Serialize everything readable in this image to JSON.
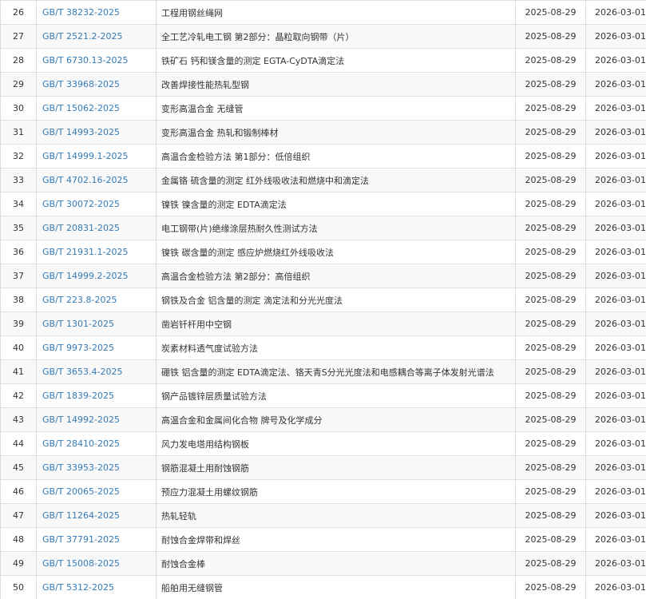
{
  "standards": [
    {
      "no": "26",
      "code": "GB/T 38232-2025",
      "name": "工程用钢丝绳网",
      "published": "2025-08-29",
      "effective": "2026-03-01"
    },
    {
      "no": "27",
      "code": "GB/T 2521.2-2025",
      "name": "全工艺冷轧电工钢 第2部分：晶粒取向钢带（片）",
      "published": "2025-08-29",
      "effective": "2026-03-01"
    },
    {
      "no": "28",
      "code": "GB/T 6730.13-2025",
      "name": "铁矿石 钙和镁含量的测定 EGTA-CyDTA滴定法",
      "published": "2025-08-29",
      "effective": "2026-03-01"
    },
    {
      "no": "29",
      "code": "GB/T 33968-2025",
      "name": "改善焊接性能热轧型钢",
      "published": "2025-08-29",
      "effective": "2026-03-01"
    },
    {
      "no": "30",
      "code": "GB/T 15062-2025",
      "name": "变形高温合金 无缝管",
      "published": "2025-08-29",
      "effective": "2026-03-01"
    },
    {
      "no": "31",
      "code": "GB/T 14993-2025",
      "name": "变形高温合金 热轧和锻制棒材",
      "published": "2025-08-29",
      "effective": "2026-03-01"
    },
    {
      "no": "32",
      "code": "GB/T 14999.1-2025",
      "name": "高温合金检验方法 第1部分：低倍组织",
      "published": "2025-08-29",
      "effective": "2026-03-01"
    },
    {
      "no": "33",
      "code": "GB/T 4702.16-2025",
      "name": "金属铬 硫含量的测定 红外线吸收法和燃烧中和滴定法",
      "published": "2025-08-29",
      "effective": "2026-03-01"
    },
    {
      "no": "34",
      "code": "GB/T 30072-2025",
      "name": "镍铁 镍含量的测定 EDTA滴定法",
      "published": "2025-08-29",
      "effective": "2026-03-01"
    },
    {
      "no": "35",
      "code": "GB/T 20831-2025",
      "name": "电工钢带(片)绝缘涂层热耐久性测试方法",
      "published": "2025-08-29",
      "effective": "2026-03-01"
    },
    {
      "no": "36",
      "code": "GB/T 21931.1-2025",
      "name": "镍铁 碳含量的测定 感应炉燃烧红外线吸收法",
      "published": "2025-08-29",
      "effective": "2026-03-01"
    },
    {
      "no": "37",
      "code": "GB/T 14999.2-2025",
      "name": "高温合金检验方法 第2部分：高倍组织",
      "published": "2025-08-29",
      "effective": "2026-03-01"
    },
    {
      "no": "38",
      "code": "GB/T 223.8-2025",
      "name": "钢铁及合金 铝含量的测定 滴定法和分光光度法",
      "published": "2025-08-29",
      "effective": "2026-03-01"
    },
    {
      "no": "39",
      "code": "GB/T 1301-2025",
      "name": "凿岩钎杆用中空钢",
      "published": "2025-08-29",
      "effective": "2026-03-01"
    },
    {
      "no": "40",
      "code": "GB/T 9973-2025",
      "name": "炭素材料透气度试验方法",
      "published": "2025-08-29",
      "effective": "2026-03-01"
    },
    {
      "no": "41",
      "code": "GB/T 3653.4-2025",
      "name": "硼铁 铝含量的测定 EDTA滴定法、铬天青S分光光度法和电感耦合等离子体发射光谱法",
      "published": "2025-08-29",
      "effective": "2026-03-01"
    },
    {
      "no": "42",
      "code": "GB/T 1839-2025",
      "name": "钢产品镀锌层质量试验方法",
      "published": "2025-08-29",
      "effective": "2026-03-01"
    },
    {
      "no": "43",
      "code": "GB/T 14992-2025",
      "name": "高温合金和金属间化合物 牌号及化学成分",
      "published": "2025-08-29",
      "effective": "2026-03-01"
    },
    {
      "no": "44",
      "code": "GB/T 28410-2025",
      "name": "风力发电塔用结构钢板",
      "published": "2025-08-29",
      "effective": "2026-03-01"
    },
    {
      "no": "45",
      "code": "GB/T 33953-2025",
      "name": "钢筋混凝土用耐蚀钢筋",
      "published": "2025-08-29",
      "effective": "2026-03-01"
    },
    {
      "no": "46",
      "code": "GB/T 20065-2025",
      "name": "预应力混凝土用螺纹钢筋",
      "published": "2025-08-29",
      "effective": "2026-03-01"
    },
    {
      "no": "47",
      "code": "GB/T 11264-2025",
      "name": "热轧轻轨",
      "published": "2025-08-29",
      "effective": "2026-03-01"
    },
    {
      "no": "48",
      "code": "GB/T 37791-2025",
      "name": "耐蚀合金焊带和焊丝",
      "published": "2025-08-29",
      "effective": "2026-03-01"
    },
    {
      "no": "49",
      "code": "GB/T 15008-2025",
      "name": "耐蚀合金棒",
      "published": "2025-08-29",
      "effective": "2026-03-01"
    },
    {
      "no": "50",
      "code": "GB/T 5312-2025",
      "name": "船舶用无缝钢管",
      "published": "2025-08-29",
      "effective": "2026-03-01"
    }
  ]
}
